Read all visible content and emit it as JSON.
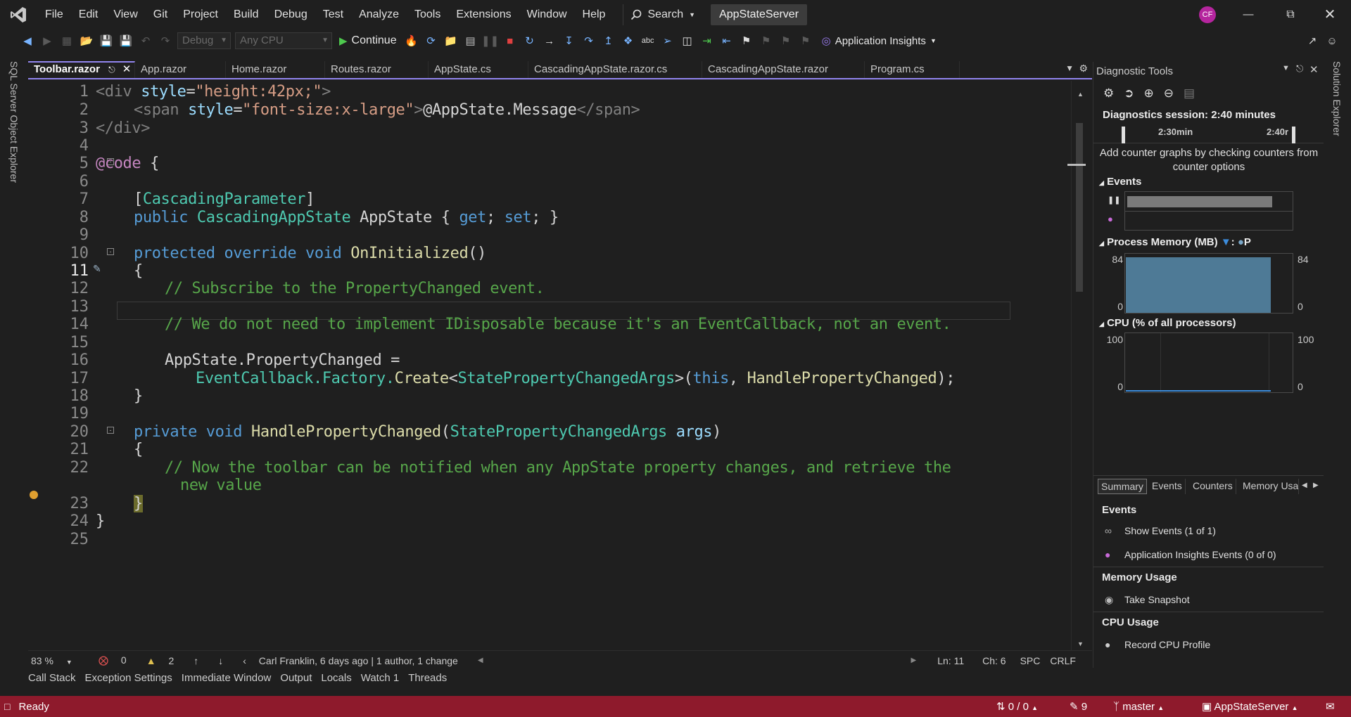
{
  "menu": [
    "File",
    "Edit",
    "View",
    "Git",
    "Project",
    "Build",
    "Debug",
    "Test",
    "Analyze",
    "Tools",
    "Extensions",
    "Window",
    "Help"
  ],
  "search_label": "Search",
  "solution_name": "AppStateServer",
  "user_initials": "CF",
  "toolbar": {
    "config": "Debug",
    "platform": "Any CPU",
    "continue_label": "Continue",
    "app_insights_label": "Application Insights"
  },
  "side_panels": {
    "left": "SQL Server Object Explorer",
    "right": "Solution Explorer"
  },
  "tabs": [
    "Toolbar.razor",
    "App.razor",
    "Home.razor",
    "Routes.razor",
    "AppState.cs",
    "CascadingAppState.razor.cs",
    "CascadingAppState.razor",
    "Program.cs"
  ],
  "line_numbers": [
    "1",
    "2",
    "3",
    "4",
    "5",
    "6",
    "7",
    "8",
    "9",
    "10",
    "11",
    "12",
    "13",
    "14",
    "15",
    "16",
    "17",
    "18",
    "19",
    "20",
    "21",
    "22",
    "23",
    "24",
    "25"
  ],
  "code": {
    "l1a": "<div ",
    "l1b": "style",
    "l1c": "=",
    "l1d": "\"height:42px;\"",
    "l1e": ">",
    "l2a": "<span ",
    "l2b": "style",
    "l2c": "=",
    "l2d": "\"font-size:x-large\"",
    "l2e": ">",
    "l2f": "@AppState.Message",
    "l2g": "</span>",
    "l3": "</div>",
    "l5a": "@code",
    "l5b": " {",
    "l7a": "[",
    "l7b": "CascadingParameter",
    "l7c": "]",
    "l8a": "public ",
    "l8b": "CascadingAppState",
    "l8c": " AppState ",
    "l8d": "{ ",
    "l8e": "get",
    "l8f": "; ",
    "l8g": "set",
    "l8h": "; }",
    "l10a": "protected override void ",
    "l10b": "OnInitialized",
    "l10c": "()",
    "l11": "{",
    "l12": "// Subscribe to the PropertyChanged event.",
    "l14": "// We do not need to implement IDisposable because it's an EventCallback, not an event.",
    "l16": "AppState.PropertyChanged =",
    "l17a": "EventCallback.Factory.",
    "l17b": "Create",
    "l17c": "<",
    "l17d": "StatePropertyChangedArgs",
    "l17e": ">(",
    "l17f": "this",
    "l17g": ", ",
    "l17h": "HandlePropertyChanged",
    "l17i": ");",
    "l18": "}",
    "l20a": "private void ",
    "l20b": "HandlePropertyChanged",
    "l20c": "(",
    "l20d": "StatePropertyChangedArgs",
    "l20e": " args",
    "l20f": ")",
    "l21": "{",
    "l22a": "// Now the toolbar can be notified when any AppState property changes, and retrieve the",
    "l22b": "new value",
    "l23": "}",
    "l24": "}"
  },
  "editor_status": {
    "zoom": "83 %",
    "errors": "0",
    "warnings": "2",
    "git_info": "Carl Franklin, 6 days ago | 1 author, 1 change",
    "line": "Ln: 11",
    "col": "Ch: 6",
    "spacing": "SPC",
    "line_ending": "CRLF"
  },
  "tool_tabs": [
    "Call Stack",
    "Exception Settings",
    "Immediate Window",
    "Output",
    "Locals",
    "Watch 1",
    "Threads"
  ],
  "status_bar": {
    "ready": "Ready",
    "changes": "0 / 0",
    "edits": "9",
    "branch": "master",
    "repo": "AppStateServer"
  },
  "diagnostics": {
    "title": "Diagnostic Tools",
    "session": "Diagnostics session: 2:40 minutes",
    "timeline_label_1": "2:30min",
    "timeline_label_2": "2:40r",
    "add_counter_hint": "Add counter graphs by checking counters from counter options",
    "events_label": "Events",
    "process_memory_label": "Process Memory (MB)",
    "memory_legend_p": "P",
    "memory_max": "84",
    "memory_min": "0",
    "memory_level": 0.94,
    "cpu_label": "CPU (% of all processors)",
    "cpu_max": "100",
    "cpu_min": "0",
    "summary_tabs": [
      "Summary",
      "Events",
      "Counters",
      "Memory Usa"
    ],
    "events_heading": "Events",
    "show_events": "Show Events (1 of 1)",
    "ai_events": "Application Insights Events (0 of 0)",
    "memory_heading": "Memory Usage",
    "take_snapshot": "Take Snapshot",
    "cpu_heading": "CPU Usage",
    "record_cpu": "Record CPU Profile"
  },
  "colors": {
    "accent": "#9184ee",
    "status_bar": "#8e1a2c",
    "memory_fill": "#4e7a96"
  }
}
